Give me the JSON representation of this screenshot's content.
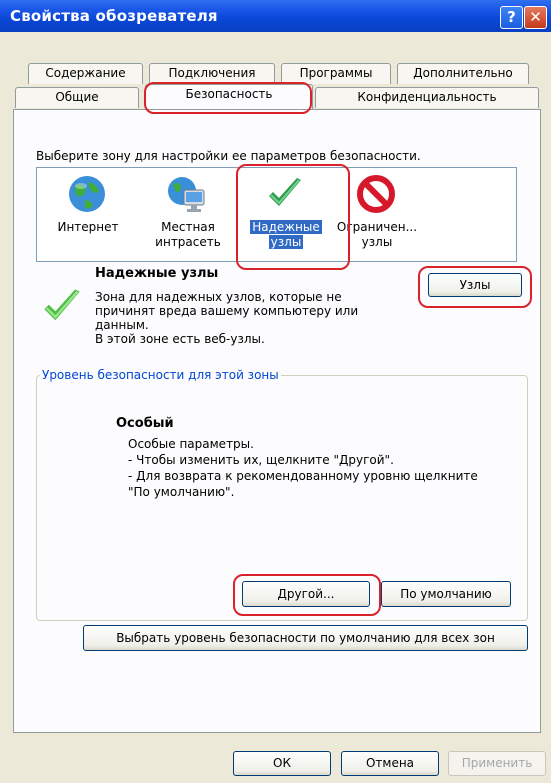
{
  "window": {
    "title": "Свойства обозревателя",
    "help_glyph": "?",
    "close_glyph": "✕"
  },
  "tabs_row1": [
    "Содержание",
    "Подключения",
    "Программы",
    "Дополнительно"
  ],
  "tabs_row2": [
    "Общие",
    "Безопасность",
    "Конфиденциальность"
  ],
  "active_tab": "Безопасность",
  "zone_prompt": "Выберите зону для настройки ее параметров безопасности.",
  "zones": [
    {
      "line1": "Интернет",
      "line2": "",
      "icon": "globe-icon"
    },
    {
      "line1": "Местная",
      "line2": "интрасеть",
      "icon": "intranet-icon"
    },
    {
      "line1": "Надежные",
      "line2": "узлы",
      "icon": "checkmark-icon"
    },
    {
      "line1": "Ограничен...",
      "line2": "узлы",
      "icon": "restricted-icon"
    }
  ],
  "selected_zone": {
    "title": "Надежные узлы",
    "description_lines": [
      "Зона для надежных узлов, которые не",
      "причинят вреда вашему компьютеру или",
      "данным.",
      "В этой зоне есть веб-узлы."
    ],
    "sites_button": "Узлы"
  },
  "security_level": {
    "group_title": "Уровень безопасности для этой зоны",
    "level_name": "Особый",
    "lines": [
      "Особые параметры.",
      "- Чтобы изменить их, щелкните \"Другой\".",
      "- Для возврата к рекомендованному уровню щелкните",
      "\"По умолчанию\"."
    ],
    "custom_button": "Другой...",
    "default_button": "По умолчанию"
  },
  "reset_all_button": "Выбрать уровень безопасности по умолчанию для всех зон",
  "footer": {
    "ok": "ОК",
    "cancel": "Отмена",
    "apply": "Применить"
  },
  "colors": {
    "titlebar": "#0b47d6",
    "highlight": "#d8232a",
    "selection": "#316ac5",
    "group_title": "#0046d5"
  }
}
